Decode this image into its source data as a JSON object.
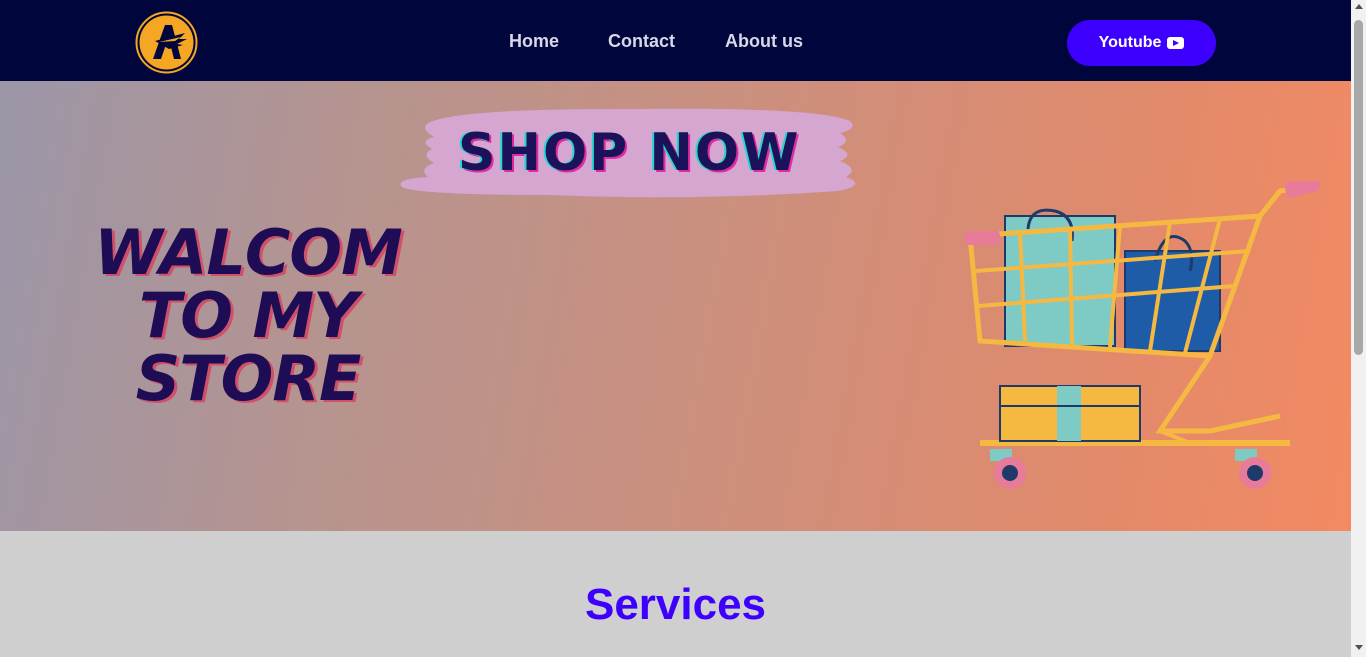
{
  "nav": {
    "logo_letter": "A",
    "links": [
      "Home",
      "Contact",
      "About us"
    ],
    "youtube_label": "Youtube",
    "icons": {
      "logo": "eagle-a-logo",
      "youtube": "youtube-play-icon"
    }
  },
  "hero": {
    "shop_now": "SHOP NOW",
    "welcome_lines": [
      "WALCOM",
      "TO MY",
      "STORE"
    ],
    "illustration": "shopping-cart-with-bags"
  },
  "services": {
    "title": "Services"
  },
  "colors": {
    "navbar": "#00053b",
    "accent": "#3d00ff",
    "hero_start": "#9b96a8",
    "hero_end": "#f38a62",
    "welcome_text": "#1e0d55",
    "section_bg": "#cfcfcf"
  }
}
